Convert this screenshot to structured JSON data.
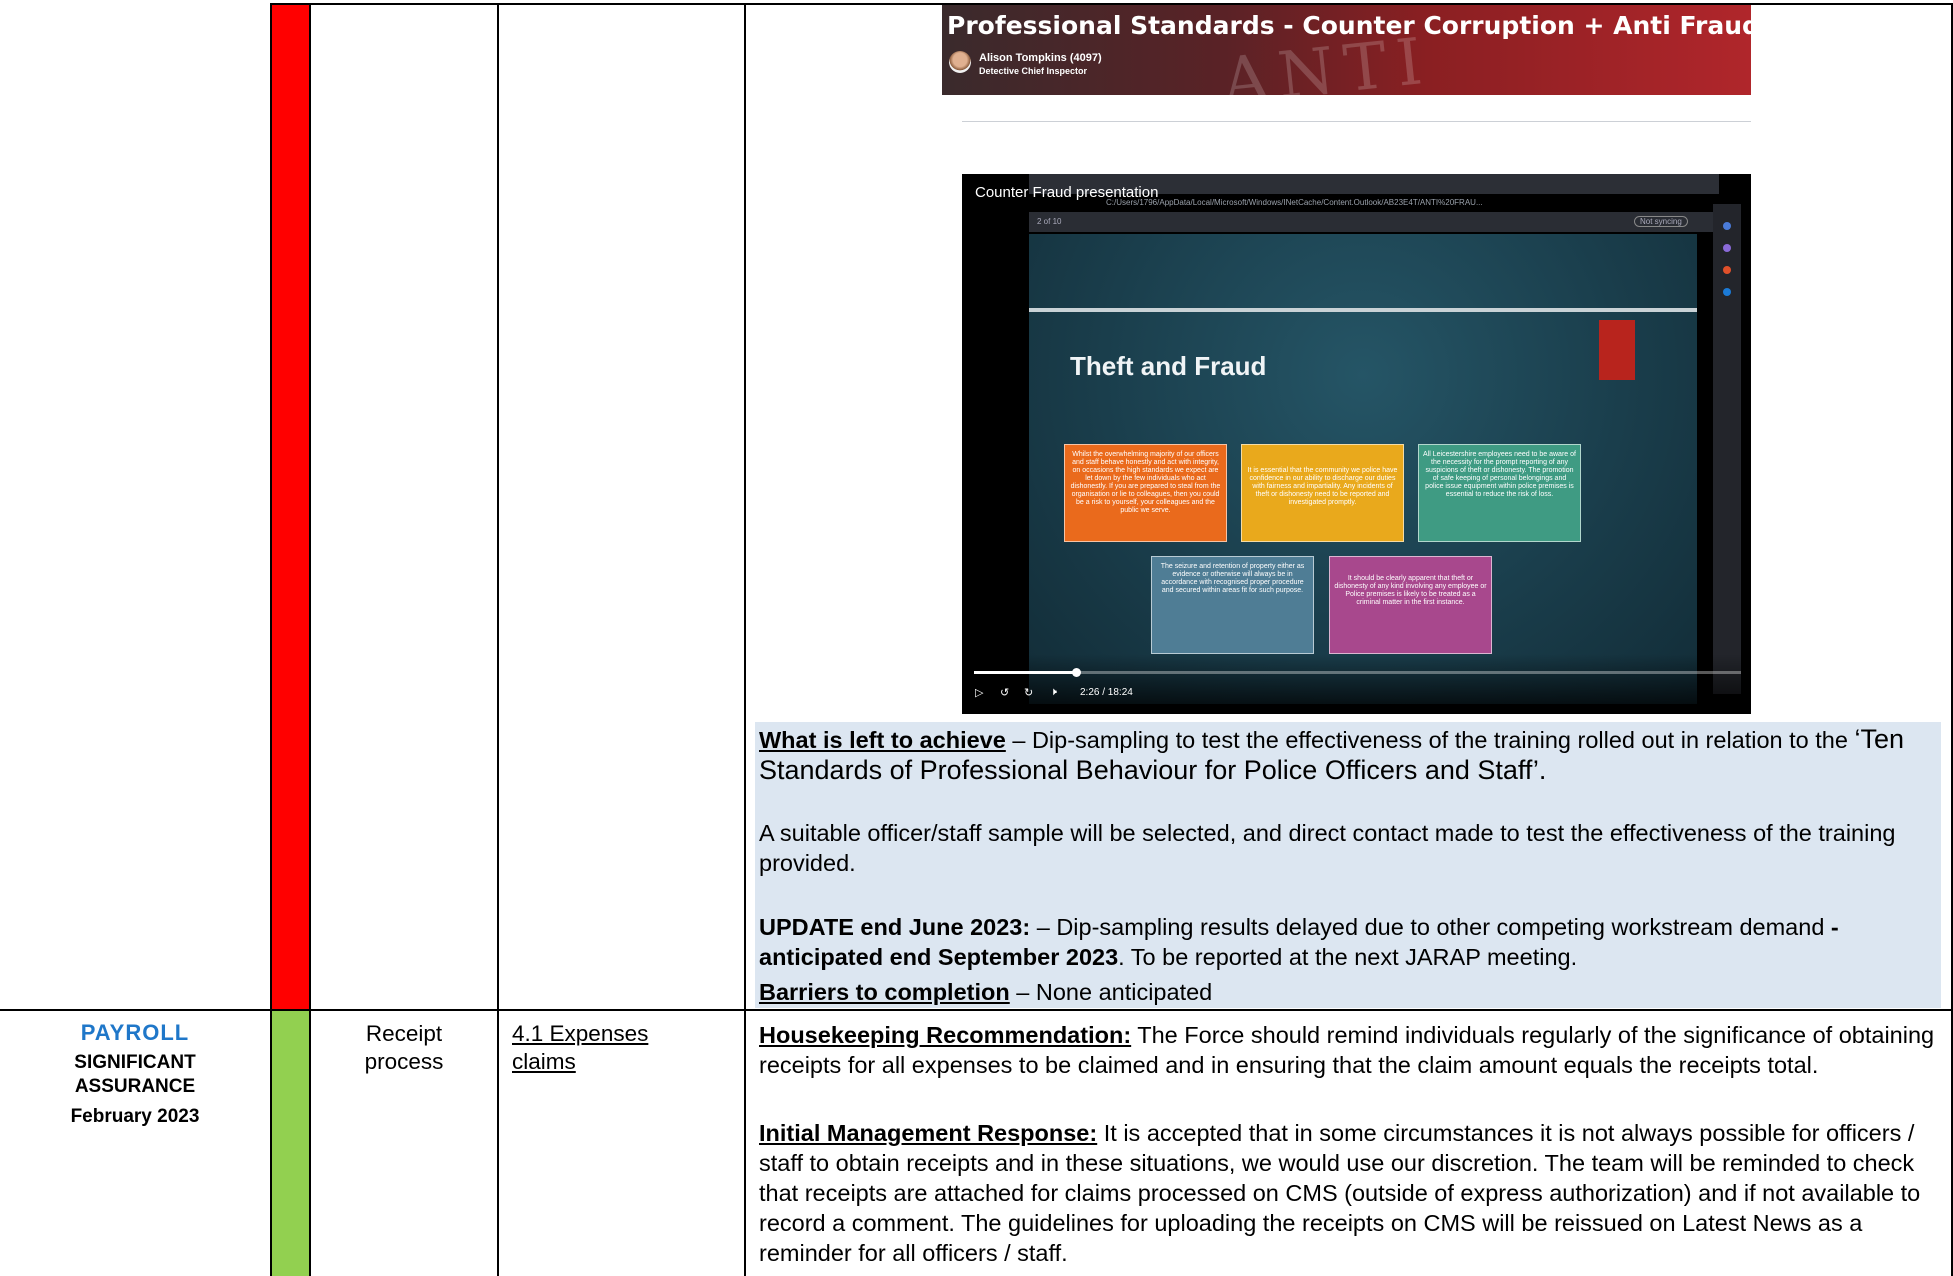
{
  "banner": {
    "title": "Professional Standards - Counter Corruption + Anti Fraud",
    "presenter": "Alison Tompkins (4097)",
    "role": "Detective Chief Inspector",
    "watermark": "ANTI"
  },
  "video": {
    "title": "Counter Fraud presentation",
    "url": "C:/Users/1796/AppData/Local/Microsoft/Windows/INetCache/Content.Outlook/AB23E4T/ANTI%20FRAU...",
    "page_indicator": "2  of 10",
    "sync_label": "Not syncing",
    "slide_title": "Theft and Fraud",
    "boxes": [
      "Whilst the overwhelming majority of our officers and staff behave honestly and act with integrity, on occasions the high standards we expect are let down by the few individuals who act dishonestly. If you are prepared to steal from the organisation or lie to colleagues, then you could be a risk to yourself, your colleagues and the public we serve.",
      "It is essential that the community we police have confidence in our ability to discharge our duties with fairness and impartiality. Any incidents of theft or dishonesty need to be reported and investigated promptly.",
      "All Leicestershire employees need to be aware of the necessity for the prompt reporting of any suspicions of theft or dishonesty. The promotion of safe keeping of personal belongings and police issue equipment within police premises is essential to reduce the risk of loss.",
      "The seizure and retention of property either as evidence or otherwise will always be in accordance with recognised proper procedure and secured within areas fit for such purpose.",
      "It should be clearly apparent that theft or dishonesty of any kind involving any employee or Police premises is likely to be treated as a criminal matter in the first instance."
    ],
    "time": "2:26 / 18:24",
    "progress_fraction": 0.133,
    "icons": [
      "play-icon",
      "rewind-10-icon",
      "forward-10-icon",
      "volume-icon"
    ]
  },
  "row1": {
    "rag_color": "#ff0000",
    "left_label": "What is left to achieve",
    "left_text": " – Dip-sampling to test the effectiveness of the training rolled out in relation to the ",
    "left_quote": "‘Ten Standards of Professional Behaviour for Police Officers and Staff’.",
    "sample_text": "A suitable officer/staff sample will be selected, and direct contact made to test the effectiveness of the training provided.",
    "update_label": "UPDATE end June 2023:",
    "update_text": " – Dip-sampling results delayed due to other competing workstream demand ",
    "update_bold": "- anticipated end September 2023",
    "update_tail": ". To be reported at the next JARAP meeting.",
    "barriers_label": "Barriers to completion",
    "barriers_text": " – None anticipated"
  },
  "row2": {
    "rag_color": "#92d050",
    "category": "PAYROLL",
    "assurance_line1": "SIGNIFICANT",
    "assurance_line2": "ASSURANCE",
    "date": "February 2023",
    "area_line1": "Receipt",
    "area_line2": "process",
    "ref_line1": "4.1 Expenses",
    "ref_line2": "claims",
    "hk_label": "Housekeeping Recommendation:",
    "hk_text": " The Force should remind individuals regularly of the significance of obtaining receipts for all expenses to be claimed and in ensuring that the claim amount equals the receipts total.",
    "imr_label": "Initial Management Response:",
    "imr_text": "  It is accepted that in some circumstances it is not always possible for officers / staff to obtain receipts and in these situations, we would use our discretion. The team will be reminded to check that receipts are attached for claims processed on CMS (outside of express authorization) and if not available to record a comment. The guidelines for uploading the receipts on CMS will be reissued on Latest News as a reminder for all officers / staff."
  }
}
